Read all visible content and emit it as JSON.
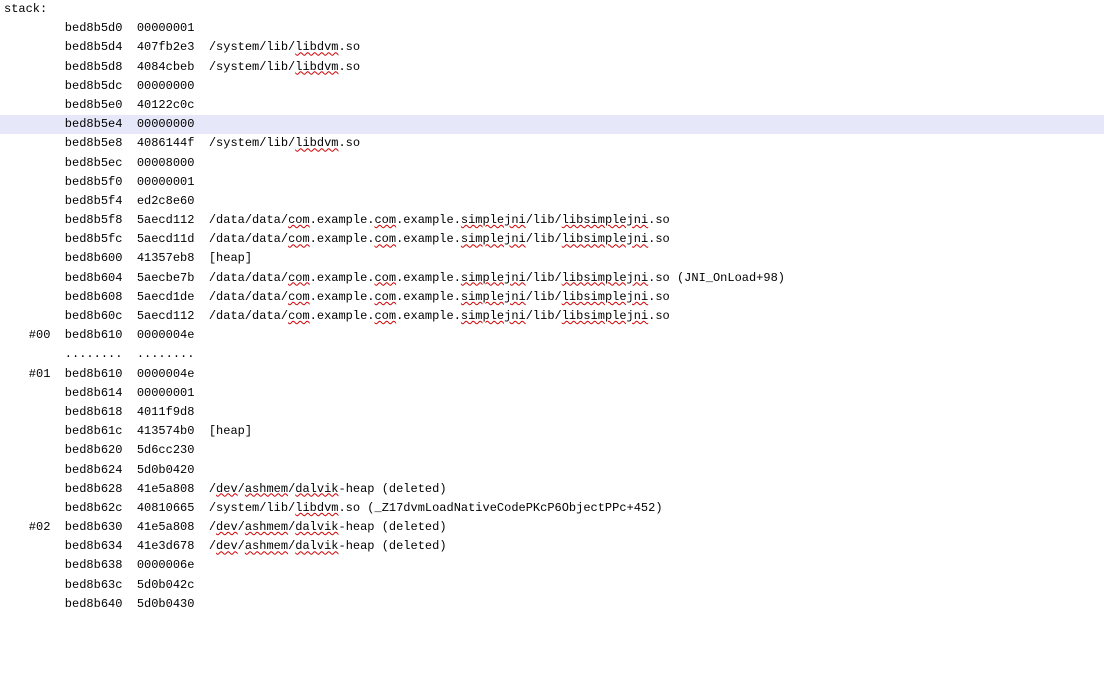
{
  "title": "stack:",
  "rows": [
    {
      "frame": "   ",
      "addr": "bed8b5d0",
      "val": "00000001",
      "note": [],
      "hl": false
    },
    {
      "frame": "   ",
      "addr": "bed8b5d4",
      "val": "407fb2e3",
      "note": [
        {
          "t": "/system/lib/"
        },
        {
          "t": "libdvm",
          "s": true
        },
        {
          "t": ".so"
        }
      ],
      "hl": false
    },
    {
      "frame": "   ",
      "addr": "bed8b5d8",
      "val": "4084cbeb",
      "note": [
        {
          "t": "/system/lib/"
        },
        {
          "t": "libdvm",
          "s": true
        },
        {
          "t": ".so"
        }
      ],
      "hl": false
    },
    {
      "frame": "   ",
      "addr": "bed8b5dc",
      "val": "00000000",
      "note": [],
      "hl": false
    },
    {
      "frame": "   ",
      "addr": "bed8b5e0",
      "val": "40122c0c",
      "note": [],
      "hl": false
    },
    {
      "frame": "   ",
      "addr": "bed8b5e4",
      "val": "00000000",
      "note": [],
      "hl": true
    },
    {
      "frame": "   ",
      "addr": "bed8b5e8",
      "val": "4086144f",
      "note": [
        {
          "t": "/system/lib/"
        },
        {
          "t": "libdvm",
          "s": true
        },
        {
          "t": ".so"
        }
      ],
      "hl": false
    },
    {
      "frame": "   ",
      "addr": "bed8b5ec",
      "val": "00008000",
      "note": [],
      "hl": false
    },
    {
      "frame": "   ",
      "addr": "bed8b5f0",
      "val": "00000001",
      "note": [],
      "hl": false
    },
    {
      "frame": "   ",
      "addr": "bed8b5f4",
      "val": "ed2c8e60",
      "note": [],
      "hl": false
    },
    {
      "frame": "   ",
      "addr": "bed8b5f8",
      "val": "5aecd112",
      "note": [
        {
          "t": "/data/data/"
        },
        {
          "t": "com",
          "s": true
        },
        {
          "t": ".example."
        },
        {
          "t": "com",
          "s": true
        },
        {
          "t": ".example."
        },
        {
          "t": "simplejni",
          "s": true
        },
        {
          "t": "/lib/"
        },
        {
          "t": "libsimplejni",
          "s": true
        },
        {
          "t": ".so"
        }
      ],
      "hl": false
    },
    {
      "frame": "   ",
      "addr": "bed8b5fc",
      "val": "5aecd11d",
      "note": [
        {
          "t": "/data/data/"
        },
        {
          "t": "com",
          "s": true
        },
        {
          "t": ".example."
        },
        {
          "t": "com",
          "s": true
        },
        {
          "t": ".example."
        },
        {
          "t": "simplejni",
          "s": true
        },
        {
          "t": "/lib/"
        },
        {
          "t": "libsimplejni",
          "s": true
        },
        {
          "t": ".so"
        }
      ],
      "hl": false
    },
    {
      "frame": "   ",
      "addr": "bed8b600",
      "val": "41357eb8",
      "note": [
        {
          "t": "[heap]"
        }
      ],
      "hl": false
    },
    {
      "frame": "   ",
      "addr": "bed8b604",
      "val": "5aecbe7b",
      "note": [
        {
          "t": "/data/data/"
        },
        {
          "t": "com",
          "s": true
        },
        {
          "t": ".example."
        },
        {
          "t": "com",
          "s": true
        },
        {
          "t": ".example."
        },
        {
          "t": "simplejni",
          "s": true
        },
        {
          "t": "/lib/"
        },
        {
          "t": "libsimplejni",
          "s": true
        },
        {
          "t": ".so (JNI_OnLoad+98)"
        }
      ],
      "hl": false
    },
    {
      "frame": "   ",
      "addr": "bed8b608",
      "val": "5aecd1de",
      "note": [
        {
          "t": "/data/data/"
        },
        {
          "t": "com",
          "s": true
        },
        {
          "t": ".example."
        },
        {
          "t": "com",
          "s": true
        },
        {
          "t": ".example."
        },
        {
          "t": "simplejni",
          "s": true
        },
        {
          "t": "/lib/"
        },
        {
          "t": "libsimplejni",
          "s": true
        },
        {
          "t": ".so"
        }
      ],
      "hl": false
    },
    {
      "frame": "   ",
      "addr": "bed8b60c",
      "val": "5aecd112",
      "note": [
        {
          "t": "/data/data/"
        },
        {
          "t": "com",
          "s": true
        },
        {
          "t": ".example."
        },
        {
          "t": "com",
          "s": true
        },
        {
          "t": ".example."
        },
        {
          "t": "simplejni",
          "s": true
        },
        {
          "t": "/lib/"
        },
        {
          "t": "libsimplejni",
          "s": true
        },
        {
          "t": ".so"
        }
      ],
      "hl": false
    },
    {
      "frame": "#00",
      "addr": "bed8b610",
      "val": "0000004e",
      "note": [],
      "hl": false
    },
    {
      "frame": "   ",
      "addr": "........",
      "val": "........",
      "note": [],
      "hl": false
    },
    {
      "frame": "#01",
      "addr": "bed8b610",
      "val": "0000004e",
      "note": [],
      "hl": false
    },
    {
      "frame": "   ",
      "addr": "bed8b614",
      "val": "00000001",
      "note": [],
      "hl": false
    },
    {
      "frame": "   ",
      "addr": "bed8b618",
      "val": "4011f9d8",
      "note": [],
      "hl": false
    },
    {
      "frame": "   ",
      "addr": "bed8b61c",
      "val": "413574b0",
      "note": [
        {
          "t": "[heap]"
        }
      ],
      "hl": false
    },
    {
      "frame": "   ",
      "addr": "bed8b620",
      "val": "5d6cc230",
      "note": [],
      "hl": false
    },
    {
      "frame": "   ",
      "addr": "bed8b624",
      "val": "5d0b0420",
      "note": [],
      "hl": false
    },
    {
      "frame": "   ",
      "addr": "bed8b628",
      "val": "41e5a808",
      "note": [
        {
          "t": "/"
        },
        {
          "t": "dev",
          "s": true
        },
        {
          "t": "/"
        },
        {
          "t": "ashmem",
          "s": true
        },
        {
          "t": "/"
        },
        {
          "t": "dalvik",
          "s": true
        },
        {
          "t": "-heap (deleted)"
        }
      ],
      "hl": false
    },
    {
      "frame": "   ",
      "addr": "bed8b62c",
      "val": "40810665",
      "note": [
        {
          "t": "/system/lib/"
        },
        {
          "t": "libdvm",
          "s": true
        },
        {
          "t": ".so (_Z17dvmLoadNativeCodePKcP6ObjectPPc+452)"
        }
      ],
      "hl": false
    },
    {
      "frame": "#02",
      "addr": "bed8b630",
      "val": "41e5a808",
      "note": [
        {
          "t": "/"
        },
        {
          "t": "dev",
          "s": true
        },
        {
          "t": "/"
        },
        {
          "t": "ashmem",
          "s": true
        },
        {
          "t": "/"
        },
        {
          "t": "dalvik",
          "s": true
        },
        {
          "t": "-heap (deleted)"
        }
      ],
      "hl": false
    },
    {
      "frame": "   ",
      "addr": "bed8b634",
      "val": "41e3d678",
      "note": [
        {
          "t": "/"
        },
        {
          "t": "dev",
          "s": true
        },
        {
          "t": "/"
        },
        {
          "t": "ashmem",
          "s": true
        },
        {
          "t": "/"
        },
        {
          "t": "dalvik",
          "s": true
        },
        {
          "t": "-heap (deleted)"
        }
      ],
      "hl": false
    },
    {
      "frame": "   ",
      "addr": "bed8b638",
      "val": "0000006e",
      "note": [],
      "hl": false
    },
    {
      "frame": "   ",
      "addr": "bed8b63c",
      "val": "5d0b042c",
      "note": [],
      "hl": false
    },
    {
      "frame": "   ",
      "addr": "bed8b640",
      "val": "5d0b0430",
      "note": [],
      "hl": false
    }
  ]
}
